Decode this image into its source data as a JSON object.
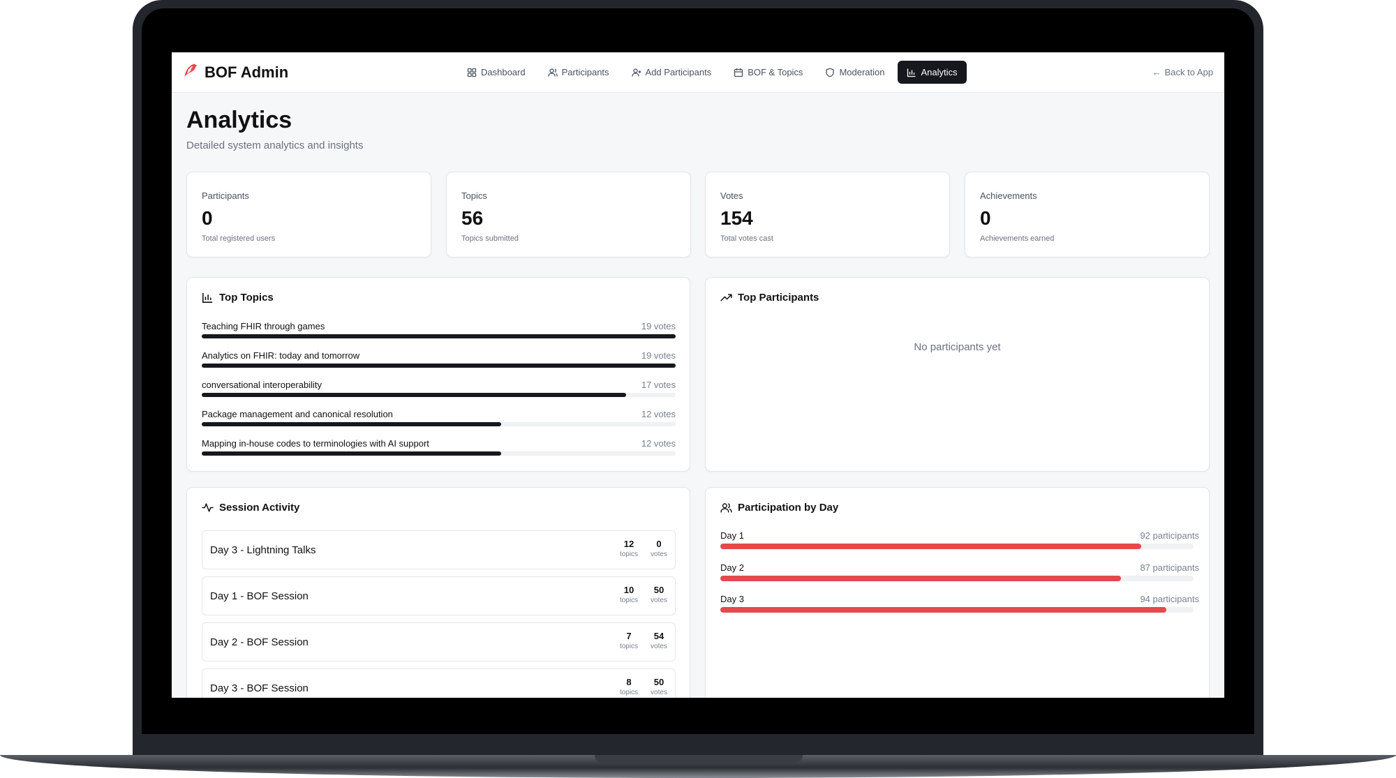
{
  "brand": {
    "title": "BOF Admin",
    "logo_color": "#e5484d"
  },
  "nav": {
    "items": [
      {
        "label": "Dashboard",
        "icon": "grid-icon",
        "active": false
      },
      {
        "label": "Participants",
        "icon": "user-icon",
        "active": false
      },
      {
        "label": "Add Participants",
        "icon": "user-plus-icon",
        "active": false
      },
      {
        "label": "BOF & Topics",
        "icon": "calendar-icon",
        "active": false
      },
      {
        "label": "Moderation",
        "icon": "shield-icon",
        "active": false
      },
      {
        "label": "Analytics",
        "icon": "bar-chart-icon",
        "active": true
      }
    ],
    "back_label": "Back to App"
  },
  "page": {
    "title": "Analytics",
    "subtitle": "Detailed system analytics and insights"
  },
  "stats": [
    {
      "label": "Participants",
      "value": "0",
      "desc": "Total registered users"
    },
    {
      "label": "Topics",
      "value": "56",
      "desc": "Topics submitted"
    },
    {
      "label": "Votes",
      "value": "154",
      "desc": "Total votes cast"
    },
    {
      "label": "Achievements",
      "value": "0",
      "desc": "Achievements earned"
    }
  ],
  "top_topics": {
    "title": "Top Topics",
    "items": [
      {
        "name": "Teaching FHIR through games",
        "votes_label": "19 votes",
        "fraction": 1.0
      },
      {
        "name": "Analytics on FHIR: today and tomorrow",
        "votes_label": "19 votes",
        "fraction": 1.0
      },
      {
        "name": "conversational interoperability",
        "votes_label": "17 votes",
        "fraction": 0.895
      },
      {
        "name": "Package management and canonical resolution",
        "votes_label": "12 votes",
        "fraction": 0.632
      },
      {
        "name": "Mapping in-house codes to terminologies with AI support",
        "votes_label": "12 votes",
        "fraction": 0.632
      }
    ]
  },
  "top_participants": {
    "title": "Top Participants",
    "empty_message": "No participants yet"
  },
  "session_activity": {
    "title": "Session Activity",
    "topics_label": "topics",
    "votes_label": "votes",
    "items": [
      {
        "name": "Day 3 - Lightning Talks",
        "topics": "12",
        "votes": "0"
      },
      {
        "name": "Day 1 - BOF Session",
        "topics": "10",
        "votes": "50"
      },
      {
        "name": "Day 2 - BOF Session",
        "topics": "7",
        "votes": "54"
      },
      {
        "name": "Day 3 - BOF Session",
        "topics": "8",
        "votes": "50"
      }
    ]
  },
  "participation_by_day": {
    "title": "Participation by Day",
    "bar_color": "#e5484d",
    "items": [
      {
        "name": "Day 1",
        "count_label": "92 participants",
        "fraction": 0.89
      },
      {
        "name": "Day 2",
        "count_label": "87 participants",
        "fraction": 0.847
      },
      {
        "name": "Day 3",
        "count_label": "94 participants",
        "fraction": 0.942
      }
    ]
  }
}
